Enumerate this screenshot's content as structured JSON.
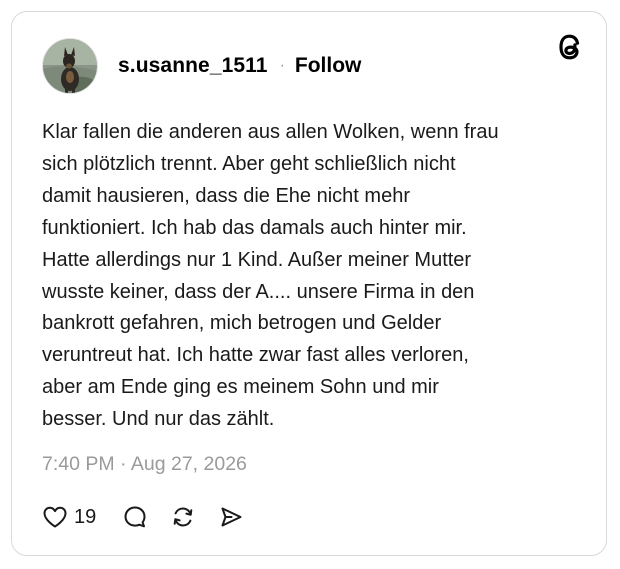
{
  "post": {
    "username": "s.usanne_1511",
    "separator": "·",
    "follow_label": "Follow",
    "body_lines": [
      "Klar fallen die anderen aus allen Wolken, wenn frau",
      "sich plötzlich trennt. Aber geht schließlich nicht",
      "damit hausieren, dass die Ehe nicht mehr",
      "funktioniert. Ich hab das damals auch hinter mir.",
      "Hatte allerdings nur 1 Kind. Außer meiner Mutter",
      "wusste keiner, dass der A.... unsere Firma in den",
      "bankrott gefahren, mich betrogen und Gelder",
      "veruntreut hat. Ich hatte zwar fast alles verloren,",
      "aber am Ende ging es meinem Sohn und mir",
      "besser. Und nur das zählt."
    ],
    "timestamp": "7:40 PM · Aug 27, 2026",
    "like_count": "19"
  },
  "icons": {
    "brand": "threads-logo-icon",
    "like": "heart-icon",
    "reply": "comment-bubble-icon",
    "repost": "repost-icon",
    "share": "send-icon"
  },
  "colors": {
    "text": "#1a1a1a",
    "muted": "#9a9a9a",
    "border": "#d9d9d9"
  }
}
